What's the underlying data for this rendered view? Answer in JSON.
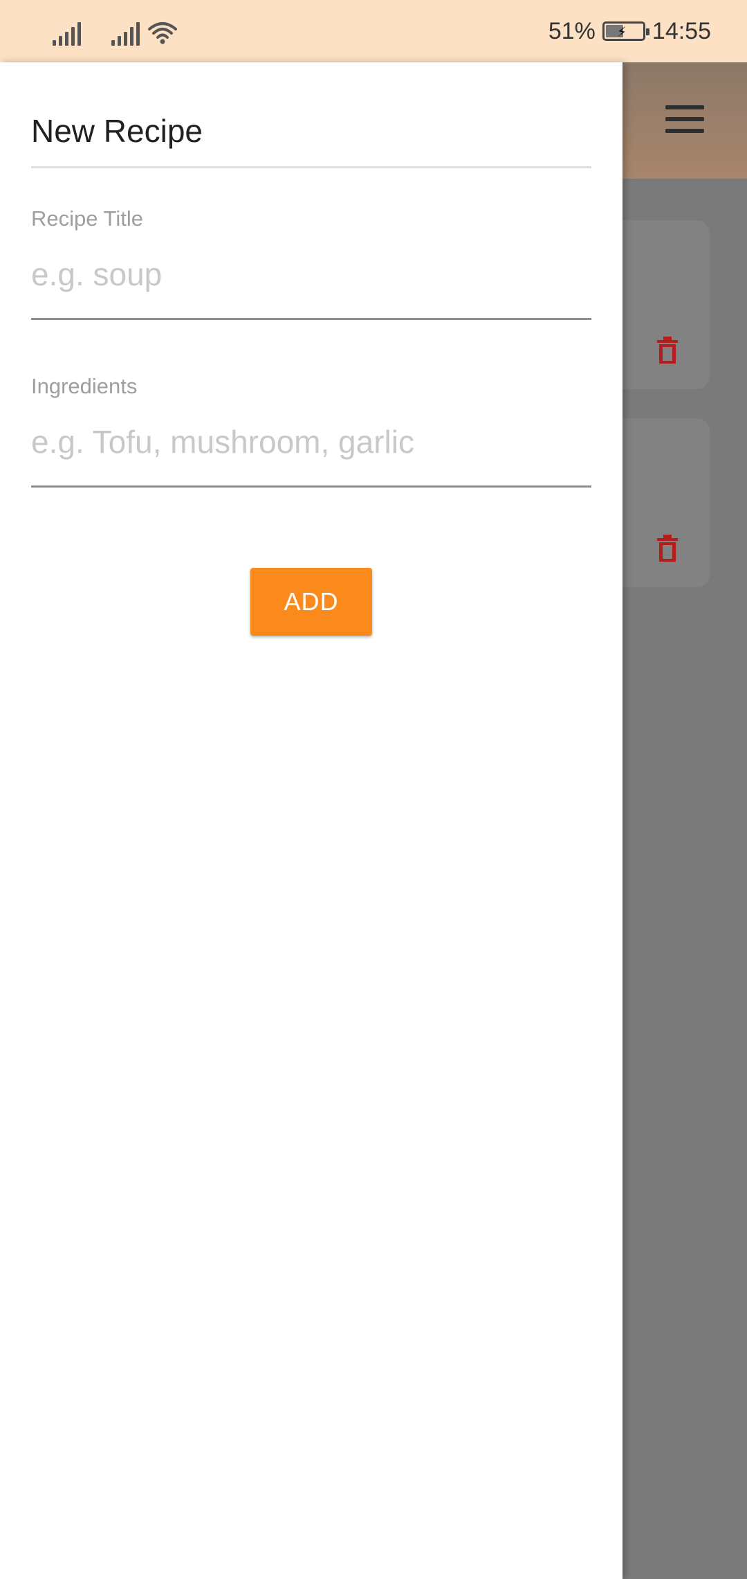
{
  "status_bar": {
    "battery_percent": "51%",
    "battery_level": 0.51,
    "time": "14:55",
    "icons": [
      "signal-icon",
      "signal-icon",
      "wifi-icon",
      "battery-charging-icon"
    ]
  },
  "drawer": {
    "title": "New Recipe",
    "fields": [
      {
        "label": "Recipe Title",
        "placeholder": "e.g. soup",
        "value": ""
      },
      {
        "label": "Ingredients",
        "placeholder": "e.g. Tofu, mushroom, garlic",
        "value": ""
      }
    ],
    "add_label": "ADD"
  },
  "background_app": {
    "menu_icon": "hamburger-menu-icon",
    "delete_icon": "trash-icon",
    "delete_icon_color": "#b71c1c"
  },
  "colors": {
    "status_bar_bg": "#fde1c5",
    "accent": "#fb8a1c",
    "scrim": "#7a7a7a"
  }
}
